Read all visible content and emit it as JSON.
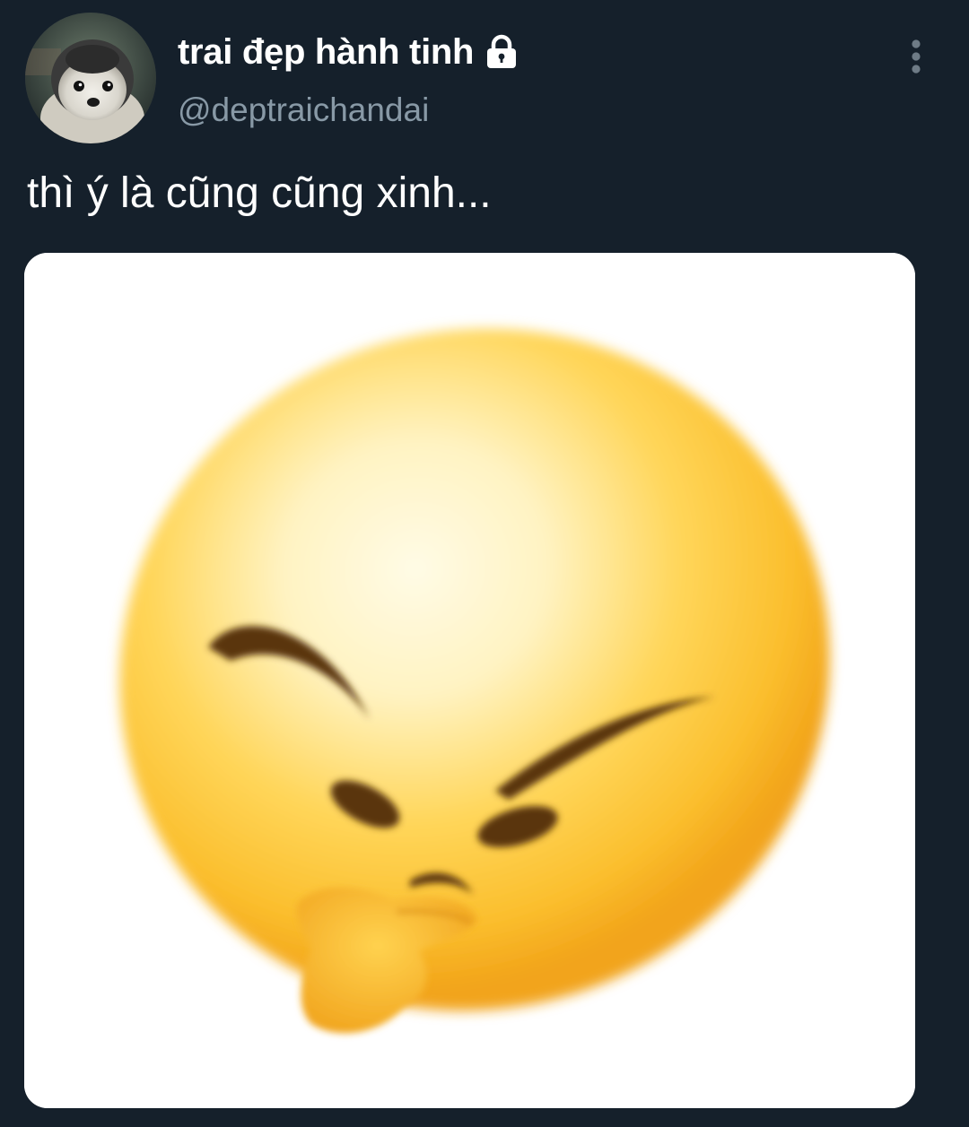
{
  "tweet": {
    "author": {
      "display_name": "trai đẹp hành tinh",
      "handle": "@deptraichandai",
      "avatar_icon": "penguin-avatar",
      "protected_icon": "lock-icon"
    },
    "text": "thì ý là cũng cũng xinh...",
    "menu_icon": "more-vertical-icon",
    "media": {
      "type": "image",
      "subject": "thinking-face-emoji"
    }
  },
  "colors": {
    "background": "#15202b",
    "primary_text": "#ffffff",
    "secondary_text": "#8899a6",
    "menu_dots": "#6e7b86",
    "emoji_yellow": "#fbbf2e",
    "emoji_brown": "#5a3410"
  }
}
